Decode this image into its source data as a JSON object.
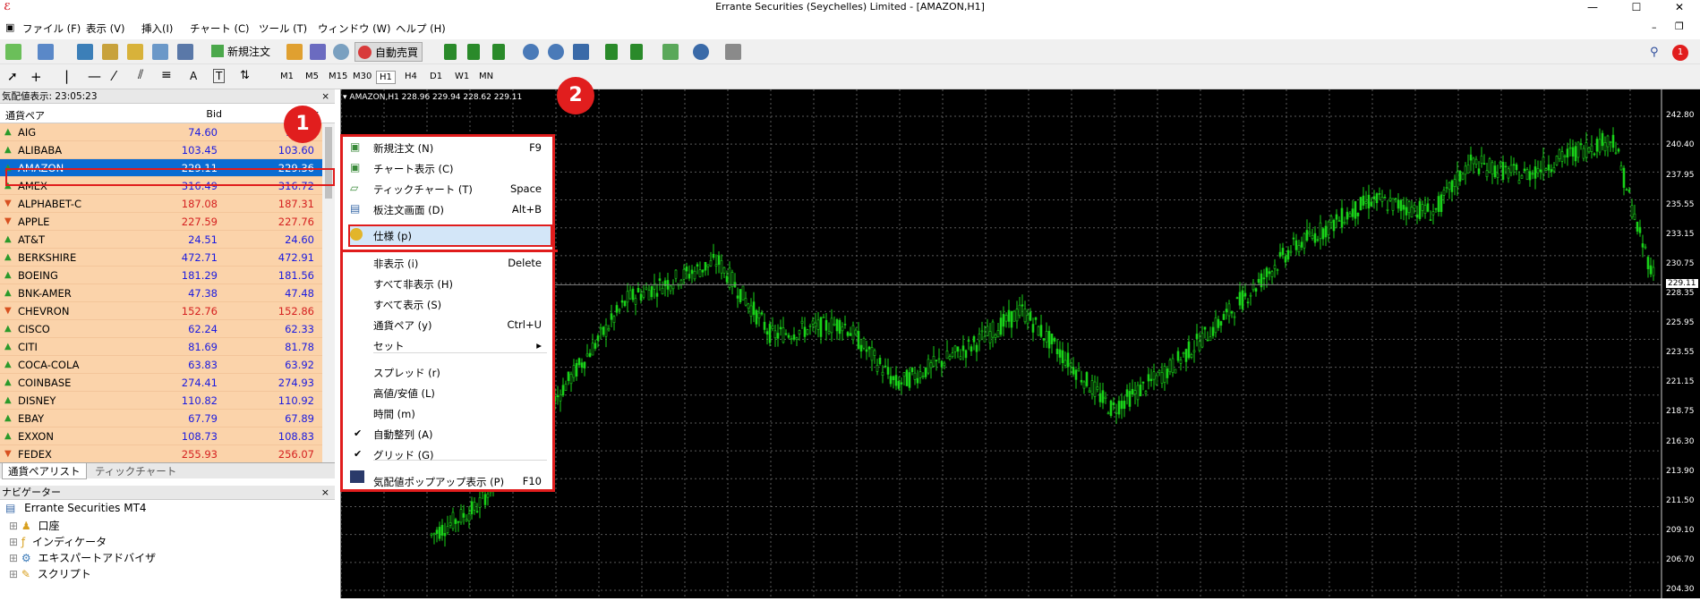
{
  "window": {
    "title": "Errante Securities (Seychelles) Limited - [AMAZON,H1]",
    "logo": "ERRANTE"
  },
  "menu": [
    "ファイル (F)",
    "表示 (V)",
    "挿入(I)",
    "チャート (C)",
    "ツール (T)",
    "ウィンドウ (W)",
    "ヘルプ (H)"
  ],
  "toolbar": {
    "new_order": "新規注文",
    "auto_trade": "自動売買"
  },
  "timeframes": [
    "M1",
    "M5",
    "M15",
    "M30",
    "H1",
    "H4",
    "D1",
    "W1",
    "MN"
  ],
  "market_watch": {
    "header": "気配値表示: 23:05:23",
    "col_symbol": "通貨ペア",
    "col_bid": "Bid",
    "col_ask": "Ask",
    "rows": [
      {
        "symbol": "AIG",
        "bid": "74.60",
        "ask": "74.72"
      },
      {
        "symbol": "ALIBABA",
        "bid": "103.45",
        "ask": "103.60"
      },
      {
        "symbol": "AMAZON",
        "bid": "229.11",
        "ask": "229.36"
      },
      {
        "symbol": "AMEX",
        "bid": "316.49",
        "ask": "316.72"
      },
      {
        "symbol": "ALPHABET-C",
        "bid": "187.08",
        "ask": "187.31"
      },
      {
        "symbol": "APPLE",
        "bid": "227.59",
        "ask": "227.76"
      },
      {
        "symbol": "AT&T",
        "bid": "24.51",
        "ask": "24.60"
      },
      {
        "symbol": "BERKSHIRE",
        "bid": "472.71",
        "ask": "472.91"
      },
      {
        "symbol": "BOEING",
        "bid": "181.29",
        "ask": "181.56"
      },
      {
        "symbol": "BNK-AMER",
        "bid": "47.38",
        "ask": "47.48"
      },
      {
        "symbol": "CHEVRON",
        "bid": "152.76",
        "ask": "152.86"
      },
      {
        "symbol": "CISCO",
        "bid": "62.24",
        "ask": "62.33"
      },
      {
        "symbol": "CITI",
        "bid": "81.69",
        "ask": "81.78"
      },
      {
        "symbol": "COCA-COLA",
        "bid": "63.83",
        "ask": "63.92"
      },
      {
        "symbol": "COINBASE",
        "bid": "274.41",
        "ask": "274.93"
      },
      {
        "symbol": "DISNEY",
        "bid": "110.82",
        "ask": "110.92"
      },
      {
        "symbol": "EBAY",
        "bid": "67.79",
        "ask": "67.89"
      },
      {
        "symbol": "EXXON",
        "bid": "108.73",
        "ask": "108.83"
      },
      {
        "symbol": "FEDEX",
        "bid": "255.93",
        "ask": "256.07"
      }
    ],
    "tabs": [
      "通貨ペアリスト",
      "ティックチャート"
    ]
  },
  "navigator": {
    "header": "ナビゲーター",
    "root": "Errante Securities MT4",
    "items": [
      "口座",
      "インディケータ",
      "エキスパートアドバイザ",
      "スクリプト"
    ]
  },
  "chart": {
    "label": "AMAZON,H1  228.96 229.94 228.62 229.11",
    "price_labels": [
      "242.80",
      "240.40",
      "237.95",
      "235.55",
      "233.15",
      "230.75",
      "229.11",
      "228.35",
      "225.95",
      "223.55",
      "221.15",
      "218.75",
      "216.30",
      "213.90",
      "211.50",
      "209.10",
      "206.70",
      "204.30"
    ],
    "current_price": "229.11"
  },
  "context_menu": {
    "items": [
      {
        "label": "新規注文 (N)",
        "key": "F9"
      },
      {
        "label": "チャート表示 (C)",
        "key": ""
      },
      {
        "label": "ティックチャート (T)",
        "key": "Space"
      },
      {
        "label": "板注文画面 (D)",
        "key": "Alt+B"
      },
      {
        "label": "仕様 (p)",
        "key": ""
      },
      {
        "label": "非表示 (i)",
        "key": "Delete"
      },
      {
        "label": "すべて非表示 (H)",
        "key": ""
      },
      {
        "label": "すべて表示 (S)",
        "key": ""
      },
      {
        "label": "通貨ペア (y)",
        "key": "Ctrl+U"
      },
      {
        "label": "セット",
        "key": "▸"
      },
      {
        "label": "スプレッド (r)",
        "key": ""
      },
      {
        "label": "高値/安値 (L)",
        "key": ""
      },
      {
        "label": "時間 (m)",
        "key": ""
      },
      {
        "label": "自動整列 (A)",
        "key": ""
      },
      {
        "label": "グリッド (G)",
        "key": ""
      },
      {
        "label": "気配値ポップアップ表示 (P)",
        "key": "F10"
      }
    ]
  },
  "badges": [
    "1",
    "2"
  ],
  "notification_count": "1",
  "colors": {
    "accent": "#e11e1e",
    "selection": "#0a6cd2",
    "row_bg": "#fbd3aa",
    "candle": "#19d219"
  }
}
